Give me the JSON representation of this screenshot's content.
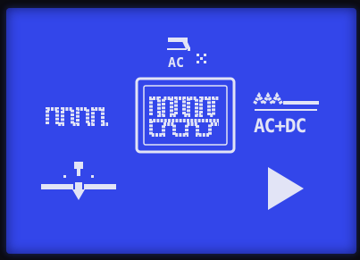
{
  "screen": {
    "background_color": "#3346ea",
    "foreground_color": "#e2e4f6",
    "bezel_color": "#0b0b12"
  },
  "top_indicator": {
    "icon": "ac-welding-torch-icon",
    "label": "AC"
  },
  "modes": [
    {
      "id": "pulse",
      "icon": "pulse-square-wave-icon",
      "selected": false
    },
    {
      "id": "ac-pulse",
      "icon": "ac-pulse-wave-icon",
      "selected": true
    },
    {
      "id": "ac-dc-mix",
      "icon": "ac-dc-mix-icon",
      "label": "AC+DC",
      "selected": false
    }
  ],
  "bottom_left": {
    "icon": "spot-weld-icon"
  },
  "bottom_right": {
    "icon": "play-triangle-icon"
  }
}
